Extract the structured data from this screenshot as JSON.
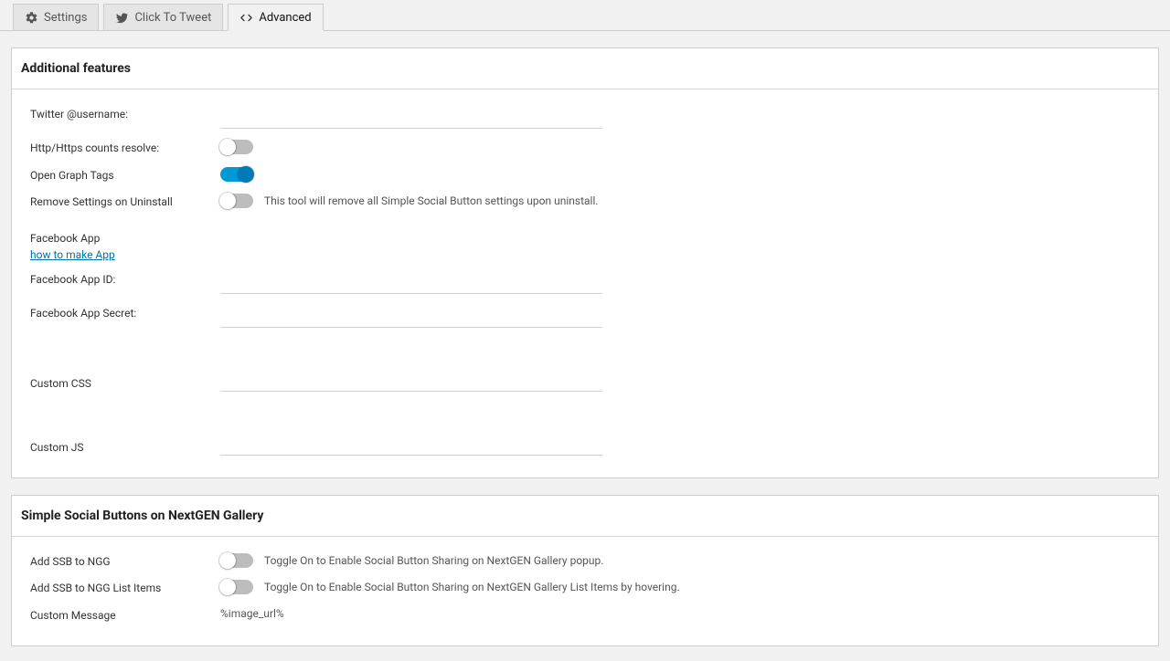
{
  "tabs": {
    "settings": "Settings",
    "click_to_tweet": "Click To Tweet",
    "advanced": "Advanced"
  },
  "panels": {
    "additional": {
      "title": "Additional features",
      "twitter_label": "Twitter @username:",
      "twitter_value": "",
      "http_label": "Http/Https counts resolve:",
      "http_on": false,
      "og_label": "Open Graph Tags",
      "og_on": true,
      "remove_label": "Remove Settings on Uninstall",
      "remove_on": false,
      "remove_desc": "This tool will remove all Simple Social Button settings upon uninstall.",
      "facebook_app_heading": "Facebook App",
      "facebook_app_link": "how to make App",
      "fb_id_label": "Facebook App ID:",
      "fb_id_value": "",
      "fb_secret_label": "Facebook App Secret:",
      "fb_secret_value": "",
      "ccss_label": "Custom CSS",
      "ccss_value": "",
      "cjs_label": "Custom JS",
      "cjs_value": ""
    },
    "ngg": {
      "title": "Simple Social Buttons on NextGEN Gallery",
      "add_label": "Add SSB to NGG",
      "add_on": false,
      "add_desc": "Toggle On to Enable Social Button Sharing on NextGEN Gallery popup.",
      "list_label": "Add SSB to NGG List Items",
      "list_on": false,
      "list_desc": "Toggle On to Enable Social Button Sharing on NextGEN Gallery List Items by hovering.",
      "msg_label": "Custom Message",
      "msg_value": "%image_url%"
    }
  }
}
